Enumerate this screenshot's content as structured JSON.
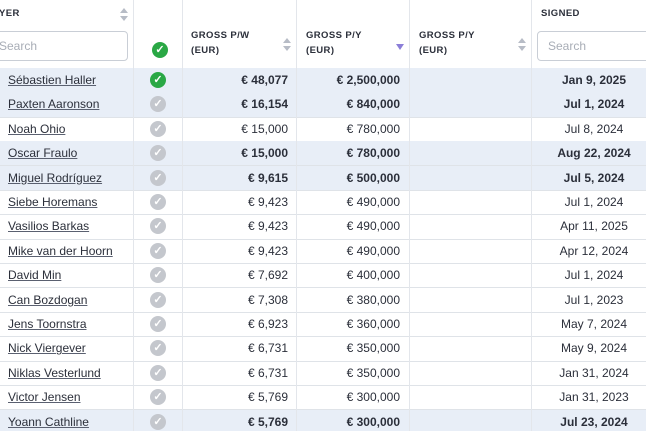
{
  "columns": {
    "player": "YER",
    "gross_pw_line1": "GROSS P/W",
    "gross_pw_line2": "(EUR)",
    "gross_py_line1": "GROSS P/Y",
    "gross_py_line2": "(EUR)",
    "gross_py2_line1": "GROSS P/Y",
    "gross_py2_line2": "(EUR)",
    "signed": "SIGNED"
  },
  "filters": {
    "player_search_placeholder": "Search",
    "signed_search_placeholder": "Search"
  },
  "rows": [
    {
      "name": "Sébastien Haller",
      "selected": true,
      "pw": "€ 48,077",
      "py": "€ 2,500,000",
      "signed": "Jan 9, 2025",
      "highlight": true
    },
    {
      "name": "Paxten Aaronson",
      "selected": false,
      "pw": "€ 16,154",
      "py": "€ 840,000",
      "signed": "Jul 1, 2024",
      "highlight": true
    },
    {
      "name": "Noah Ohio",
      "selected": false,
      "pw": "€ 15,000",
      "py": "€ 780,000",
      "signed": "Jul 8, 2024",
      "highlight": false
    },
    {
      "name": "Oscar Fraulo",
      "selected": false,
      "pw": "€ 15,000",
      "py": "€ 780,000",
      "signed": "Aug 22, 2024",
      "highlight": true
    },
    {
      "name": "Miguel Rodríguez",
      "selected": false,
      "pw": "€ 9,615",
      "py": "€ 500,000",
      "signed": "Jul 5, 2024",
      "highlight": true
    },
    {
      "name": "Siebe Horemans",
      "selected": false,
      "pw": "€ 9,423",
      "py": "€ 490,000",
      "signed": "Jul 1, 2024",
      "highlight": false
    },
    {
      "name": "Vasilios Barkas",
      "selected": false,
      "pw": "€ 9,423",
      "py": "€ 490,000",
      "signed": "Apr 11, 2025",
      "highlight": false
    },
    {
      "name": "Mike van der Hoorn",
      "selected": false,
      "pw": "€ 9,423",
      "py": "€ 490,000",
      "signed": "Apr 12, 2024",
      "highlight": false
    },
    {
      "name": "David Min",
      "selected": false,
      "pw": "€ 7,692",
      "py": "€ 400,000",
      "signed": "Jul 1, 2024",
      "highlight": false
    },
    {
      "name": "Can Bozdogan",
      "selected": false,
      "pw": "€ 7,308",
      "py": "€ 380,000",
      "signed": "Jul 1, 2023",
      "highlight": false
    },
    {
      "name": "Jens Toornstra",
      "selected": false,
      "pw": "€ 6,923",
      "py": "€ 360,000",
      "signed": "May 7, 2024",
      "highlight": false
    },
    {
      "name": "Nick Viergever",
      "selected": false,
      "pw": "€ 6,731",
      "py": "€ 350,000",
      "signed": "May 9, 2024",
      "highlight": false
    },
    {
      "name": "Niklas Vesterlund",
      "selected": false,
      "pw": "€ 6,731",
      "py": "€ 350,000",
      "signed": "Jan 31, 2024",
      "highlight": false
    },
    {
      "name": "Victor Jensen",
      "selected": false,
      "pw": "€ 5,769",
      "py": "€ 300,000",
      "signed": "Jan 31, 2023",
      "highlight": false
    },
    {
      "name": "Yoann Cathline",
      "selected": false,
      "pw": "€ 5,769",
      "py": "€ 300,000",
      "signed": "Jul 23, 2024",
      "highlight": true
    }
  ],
  "colors": {
    "selected": "#2aa845",
    "unselected": "#c4c7cd",
    "highlight": "#e8eef7",
    "sort_active": "#8b7ed8"
  }
}
